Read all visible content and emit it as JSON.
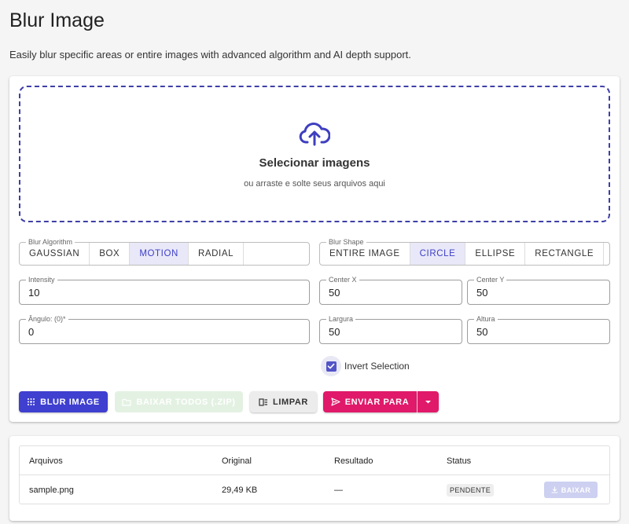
{
  "header": {
    "title": "Blur Image",
    "subtitle": "Easily blur specific areas or entire images with advanced algorithm and AI depth support."
  },
  "dropzone": {
    "title": "Selecionar imagens",
    "subtitle": "ou arraste e solte seus arquivos aqui",
    "icon": "cloud-upload-icon"
  },
  "algorithm": {
    "legend": "Blur Algorithm",
    "options": [
      "GAUSSIAN",
      "BOX",
      "MOTION",
      "RADIAL"
    ],
    "selected": "MOTION"
  },
  "shape": {
    "legend": "Blur Shape",
    "options": [
      "ENTIRE IMAGE",
      "CIRCLE",
      "ELLIPSE",
      "RECTANGLE"
    ],
    "selected": "CIRCLE"
  },
  "fields": {
    "intensity": {
      "label": "Intensity",
      "value": "10"
    },
    "center_x": {
      "label": "Center X",
      "value": "50"
    },
    "center_y": {
      "label": "Center Y",
      "value": "50"
    },
    "angle": {
      "label": "Ângulo: (0)*",
      "value": "0"
    },
    "width": {
      "label": "Largura",
      "value": "50"
    },
    "height": {
      "label": "Altura",
      "value": "50"
    }
  },
  "invert": {
    "label": "Invert Selection",
    "checked": true
  },
  "actions": {
    "blur": "BLUR IMAGE",
    "zip": "BAIXAR TODOS (.ZIP)",
    "clear": "LIMPAR",
    "send": "ENVIAR PARA"
  },
  "table": {
    "headers": [
      "Arquivos",
      "Original",
      "Resultado",
      "Status"
    ],
    "rows": [
      {
        "file": "sample.png",
        "original": "29,49 KB",
        "result": "—",
        "status": "PENDENTE",
        "action": "BAIXAR"
      }
    ]
  },
  "colors": {
    "primary": "#3f3fd0",
    "accent": "#e0196a",
    "dropzone_border": "#3f3fa8",
    "selected_segment": "#e8e8f8"
  }
}
